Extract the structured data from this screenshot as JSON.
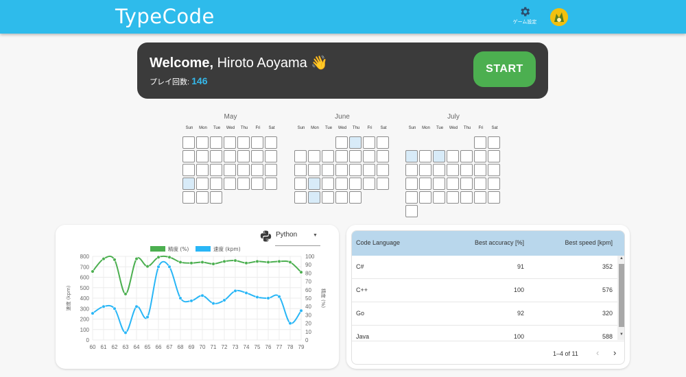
{
  "header": {
    "brand": "TypeCode",
    "settings_label": "ゲーム設定",
    "settings_icon": "gear-icon",
    "avatar_icon": "avatar-icon"
  },
  "welcome": {
    "greeting": "Welcome,",
    "user_name": "Hiroto Aoyama",
    "emoji": "👋",
    "play_label": "プレイ回数:",
    "play_count": "146",
    "start_label": "START"
  },
  "calendar": {
    "dows": [
      "Sun",
      "Mon",
      "Tue",
      "Wed",
      "Thu",
      "Fri",
      "Sat"
    ],
    "months": [
      {
        "name": "May",
        "first_weekday": 0,
        "days": 31,
        "active_days": [
          22
        ]
      },
      {
        "name": "June",
        "first_weekday": 3,
        "days": 30,
        "active_days": [
          2,
          20,
          27
        ]
      },
      {
        "name": "July",
        "first_weekday": 5,
        "days": 31,
        "active_days": [
          3,
          5
        ]
      }
    ]
  },
  "chart_controls": {
    "language_value": "Python",
    "language_icon": "python-icon"
  },
  "chart_data": {
    "type": "line",
    "x": [
      60,
      61,
      62,
      63,
      64,
      65,
      66,
      67,
      68,
      69,
      70,
      71,
      72,
      73,
      74,
      75,
      76,
      77,
      78,
      79
    ],
    "series": [
      {
        "name": "精度 (%)",
        "axis": "right",
        "color": "#4caf50",
        "values": [
          82,
          97,
          96,
          55,
          97,
          88,
          99,
          99,
          93,
          92,
          93,
          91,
          94,
          95,
          92,
          94,
          93,
          94,
          93,
          81
        ]
      },
      {
        "name": "速度 (kpm)",
        "axis": "left",
        "color": "#29b6f6",
        "values": [
          255,
          320,
          300,
          70,
          320,
          220,
          700,
          700,
          400,
          375,
          425,
          350,
          380,
          470,
          450,
          410,
          400,
          415,
          160,
          280
        ]
      }
    ],
    "ylabel": "速度 (kpm)",
    "y2label": "精度 (%)",
    "ylim": [
      0,
      800
    ],
    "y2lim": [
      0,
      100
    ],
    "yticks": [
      0,
      100,
      200,
      300,
      400,
      500,
      600,
      700,
      800
    ],
    "y2ticks": [
      0,
      10,
      20,
      30,
      40,
      50,
      60,
      70,
      80,
      90,
      100
    ],
    "grid": true,
    "legend": "top"
  },
  "table": {
    "headers": [
      "Code Language",
      "Best accuracy [%]",
      "Best speed [kpm]"
    ],
    "rows": [
      [
        "C#",
        "91",
        "352"
      ],
      [
        "C++",
        "100",
        "576"
      ],
      [
        "Go",
        "92",
        "320"
      ],
      [
        "Java",
        "100",
        "588"
      ]
    ],
    "pagination": "1–4 of 11"
  }
}
